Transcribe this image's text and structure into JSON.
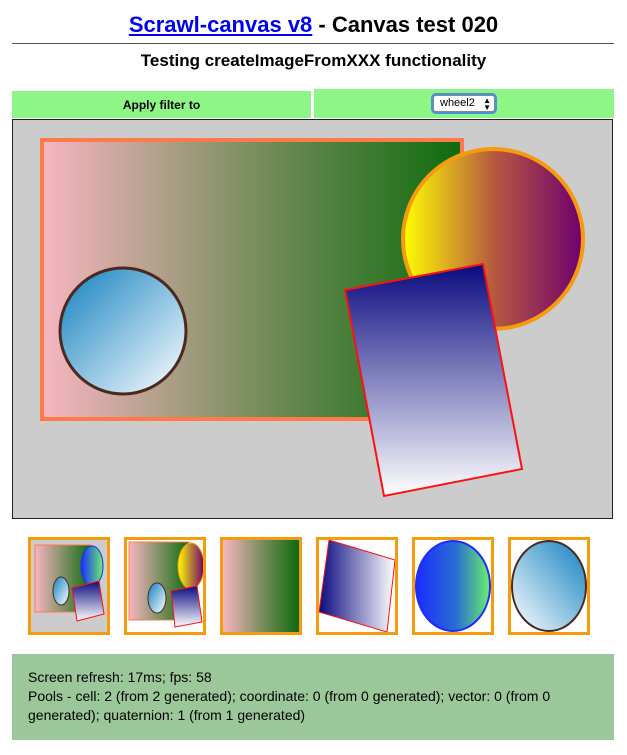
{
  "header": {
    "title_link": "Scrawl-canvas v8",
    "title_rest": " - Canvas test 020",
    "subtitle": "Testing createImageFromXXX functionality"
  },
  "controls": {
    "filter_label": "Apply filter to",
    "filter_select_value": "wheel2"
  },
  "thumbnails": [
    {
      "name": "group-snapshot-thumbnail",
      "active": true
    },
    {
      "name": "cell-snapshot-thumbnail",
      "active": false
    },
    {
      "name": "gradient-block-thumbnail",
      "active": false
    },
    {
      "name": "blue-block-thumbnail",
      "active": false
    },
    {
      "name": "wheel1-thumbnail",
      "active": false
    },
    {
      "name": "wheel2-thumbnail",
      "active": false
    }
  ],
  "report": {
    "line1": "Screen refresh: 17ms; fps: 58",
    "line2": "Pools - cell: 2 (from 2 generated); coordinate: 0 (from 0 generated); vector: 0 (from 0 generated); quaternion: 1 (from 1 generated)"
  },
  "colors": {
    "controls_bg": "#8ef587",
    "canvas_bg": "#cccccc",
    "thumb_border": "#f69a0e",
    "report_bg": "#9cc79b",
    "link": "#0000ee"
  }
}
